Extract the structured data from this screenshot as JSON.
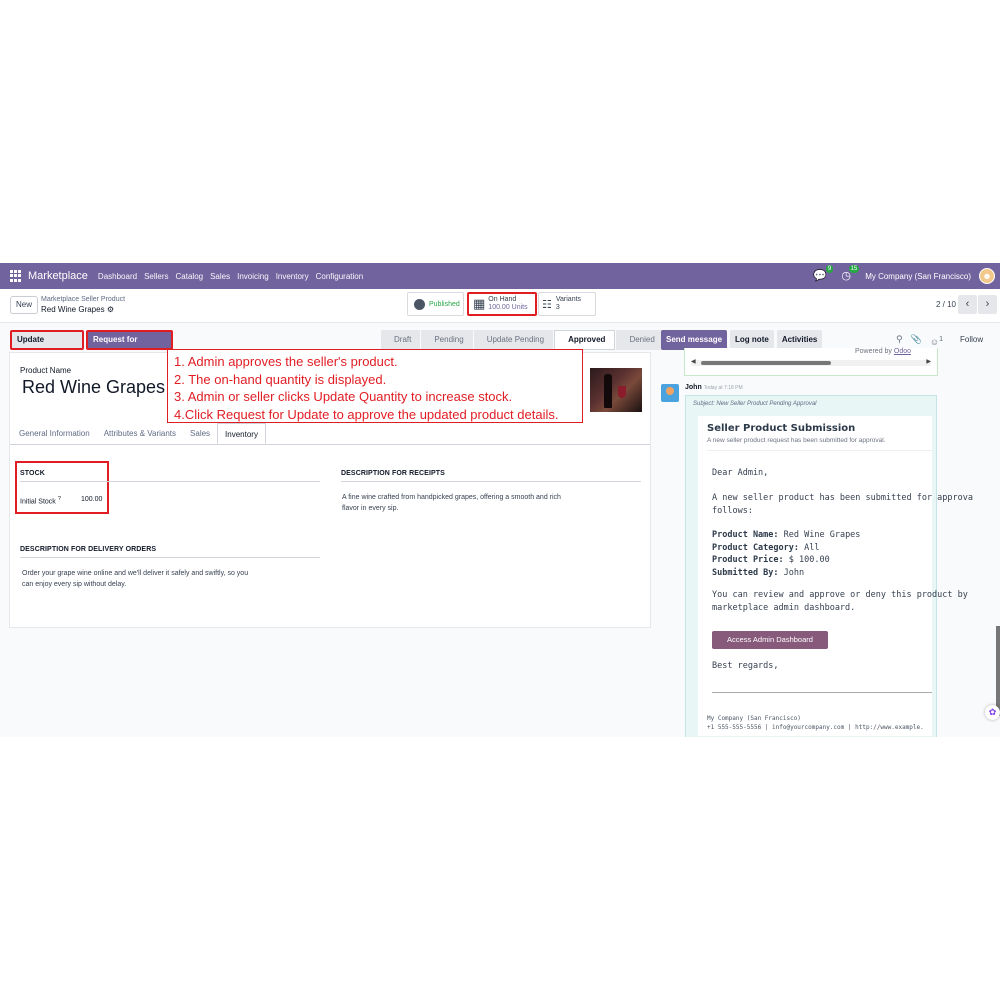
{
  "nav": {
    "brand": "Marketplace",
    "menu": [
      "Dashboard",
      "Sellers",
      "Catalog",
      "Sales",
      "Invoicing",
      "Inventory",
      "Configuration"
    ],
    "messages_badge": "9",
    "activity_badge": "15",
    "company": "My Company (San Francisco)"
  },
  "control": {
    "new_label": "New",
    "breadcrumb_parent": "Marketplace Seller Product",
    "breadcrumb_current": "Red Wine Grapes",
    "published_label": "Published",
    "onhand_label": "On Hand",
    "onhand_value": "100.00 Units",
    "variants_label": "Variants",
    "variants_value": "3",
    "pager": "2 / 10"
  },
  "actions": {
    "update_quantity": "Update Quantity",
    "request_update": "Request for Update"
  },
  "status_stages": [
    "Draft",
    "Pending",
    "Update Pending",
    "Approved",
    "Denied"
  ],
  "status_active": "Approved",
  "chatter_buttons": {
    "send": "Send message",
    "log": "Log note",
    "activities": "Activities",
    "follow": "Follow",
    "followers_count": "1"
  },
  "annotation": [
    "1. Admin approves the seller's product.",
    "2. The on-hand quantity is displayed.",
    "3. Admin or seller clicks Update Quantity to increase stock.",
    "4.Click Request for Update to approve the updated product details."
  ],
  "form": {
    "product_name_label": "Product Name",
    "product_name": "Red Wine Grapes",
    "tabs": [
      "General Information",
      "Attributes & Variants",
      "Sales",
      "Inventory"
    ],
    "active_tab": "Inventory",
    "stock_title": "STOCK",
    "initial_stock_label": "Initial Stock",
    "initial_stock_tip": "?",
    "initial_stock_value": "100.00",
    "receipts_title": "DESCRIPTION FOR RECEIPTS",
    "receipts_text_1": "A fine wine crafted from handpicked grapes, offering a smooth and rich",
    "receipts_text_2": "flavor in every sip.",
    "delivery_title": "DESCRIPTION FOR DELIVERY ORDERS",
    "delivery_text_1": "Order your grape wine online and we'll deliver it safely and swiftly, so you",
    "delivery_text_2": "can enjoy every sip without delay."
  },
  "chatter": {
    "powered_by": "Powered by",
    "powered_link": "Odoo",
    "author": "John",
    "time": "Today at 7:18 PM",
    "subject": "Subject: New Seller Product Pending Approval",
    "mail_title": "Seller Product Submission",
    "mail_subtitle": "A new seller product request has been submitted for approval.",
    "greeting": "Dear Admin,",
    "intro_1": "A new seller product has been submitted for approva",
    "intro_2": "follows:",
    "name_label": "Product Name:",
    "name_value": "Red Wine Grapes",
    "category_label": "Product Category:",
    "category_value": "All",
    "price_label": "Product Price:",
    "price_value": "$ 100.00",
    "submitted_label": "Submitted By:",
    "submitted_value": "John",
    "review_1": "You can review and approve or deny this product by",
    "review_2": "marketplace admin dashboard.",
    "access_button": "Access Admin Dashboard",
    "regards": "Best regards,",
    "footer_company": "My Company (San Francisco)",
    "footer_contact": "+1 555-555-5556 | info@yourcompany.com | http://www.example."
  },
  "colors": {
    "brand": "#71639e",
    "annotation": "#e11d24",
    "mail_button": "#875a7b",
    "published": "#28a745"
  }
}
